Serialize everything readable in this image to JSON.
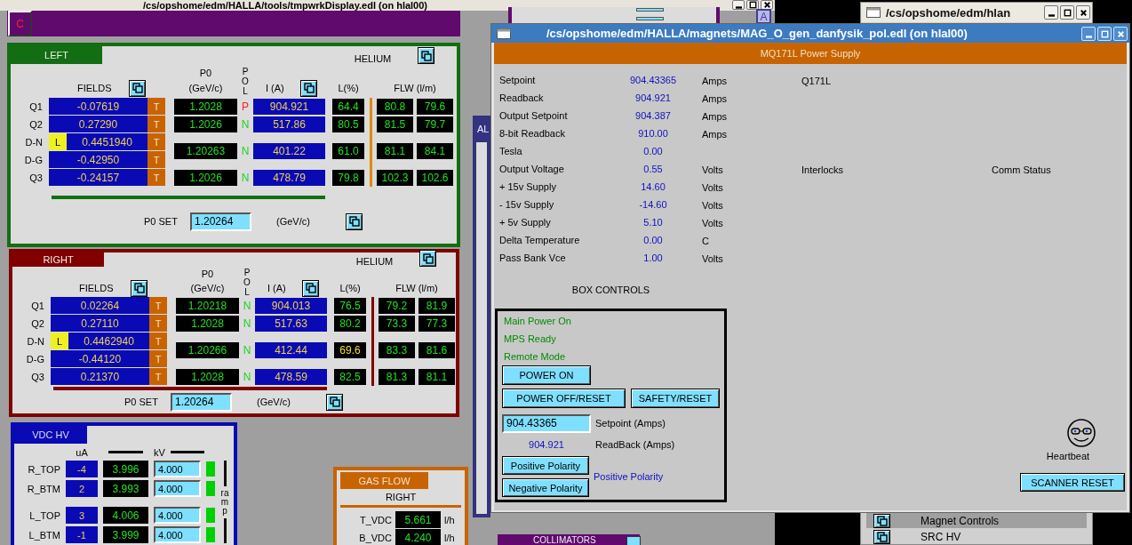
{
  "background_window": {
    "title": "/cs/opshome/edm/HALLA/tools/tmpwrkDisplay.edl (on hlal00)",
    "header_button": "C",
    "corner_button": "A",
    "alarm_panel_title": "AL",
    "collimators_title": "COLLIMATORS",
    "magnet_panels": [
      {
        "title": "LEFT",
        "color": "#136e13",
        "headers": {
          "fields": "FIELDS",
          "p0": "P0",
          "p0_unit": "(GeV/c)",
          "pol": "POL",
          "current": "I (A)",
          "helium": "HELIUM",
          "level": "L(%)",
          "flow": "FLW (l/m)"
        },
        "fields": [
          {
            "name": "Q1",
            "value": "-0.07619",
            "tag": "T"
          },
          {
            "name": "Q2",
            "value": "0.27290",
            "tag": "T"
          },
          {
            "name": "D-N",
            "value": "0.4451940",
            "tag": "T",
            "flag": "L"
          },
          {
            "name": "D-G",
            "value": "-0.42950",
            "tag": "T"
          },
          {
            "name": "Q3",
            "value": "-0.24157",
            "tag": "T"
          }
        ],
        "magnets": [
          {
            "p0": "1.2028",
            "pol": "P",
            "color": "#ff2020",
            "current": "904.921",
            "level": "64.4",
            "level_warning": false,
            "flow": [
              "80.8",
              "79.6"
            ]
          },
          {
            "p0": "1.2026",
            "pol": "N",
            "color": "#20d020",
            "current": "517.86",
            "level": "80.5",
            "level_warning": false,
            "flow": [
              "81.5",
              "79.7"
            ]
          },
          {
            "p0": "1.20263",
            "pol": "N",
            "color": "#20d020",
            "current": "401.22",
            "level": "61.0",
            "level_warning": false,
            "flow": [
              "81.1",
              "84.1"
            ]
          },
          {
            "p0": "1.2026",
            "pol": "N",
            "color": "#20d020",
            "current": "478.79",
            "level": "79.8",
            "level_warning": false,
            "flow": [
              "102.3",
              "102.6"
            ]
          }
        ],
        "p0_set": {
          "label": "P0 SET",
          "value": "1.20264",
          "unit": "(GeV/c)"
        }
      },
      {
        "title": "RIGHT",
        "color": "#800000",
        "headers": {
          "fields": "FIELDS",
          "p0": "P0",
          "p0_unit": "(GeV/c)",
          "pol": "POL",
          "current": "I (A)",
          "helium": "HELIUM",
          "level": "L(%)",
          "flow": "FLW (l/m)"
        },
        "fields": [
          {
            "name": "Q1",
            "value": "0.02264",
            "tag": "T"
          },
          {
            "name": "Q2",
            "value": "0.27110",
            "tag": "T"
          },
          {
            "name": "D-N",
            "value": "0.4462940",
            "tag": "T",
            "flag": "L"
          },
          {
            "name": "D-G",
            "value": "-0.44120",
            "tag": "T"
          },
          {
            "name": "Q3",
            "value": "0.21370",
            "tag": "T"
          }
        ],
        "magnets": [
          {
            "p0": "1.20218",
            "pol": "N",
            "color": "#20d020",
            "current": "904.013",
            "level": "76.5",
            "level_warning": false,
            "flow": [
              "79.2",
              "81.9"
            ]
          },
          {
            "p0": "1.2028",
            "pol": "N",
            "color": "#20d020",
            "current": "517.63",
            "level": "80.2",
            "level_warning": false,
            "flow": [
              "73.3",
              "77.3"
            ]
          },
          {
            "p0": "1.20266",
            "pol": "N",
            "color": "#20d020",
            "current": "412.44",
            "level": "69.6",
            "level_warning": true,
            "flow": [
              "83.3",
              "81.6"
            ]
          },
          {
            "p0": "1.2028",
            "pol": "N",
            "color": "#20d020",
            "current": "478.59",
            "level": "82.5",
            "level_warning": false,
            "flow": [
              "81.3",
              "81.1"
            ]
          }
        ],
        "p0_set": {
          "label": "P0 SET",
          "value": "1.20264",
          "unit": "(GeV/c)"
        }
      }
    ],
    "vdc_hv": {
      "title": "VDC HV",
      "current_unit": "uA",
      "voltage_unit": "kV",
      "ramp_label": "ramp",
      "channels": [
        {
          "name": "R_TOP",
          "current": "-4",
          "readback": "3.996",
          "setpoint": "4.000",
          "ok": true
        },
        {
          "name": "R_BTM",
          "current": "2",
          "readback": "3.993",
          "setpoint": "4.000",
          "ok": true
        },
        {
          "name": "L_TOP",
          "current": "3",
          "readback": "4.006",
          "setpoint": "4.000",
          "ok": true
        },
        {
          "name": "L_BTM",
          "current": "-1",
          "readback": "3.999",
          "setpoint": "4.000",
          "ok": true
        }
      ]
    },
    "gas_flow": {
      "title": "GAS FLOW",
      "side": "RIGHT",
      "rows": [
        {
          "name": "T_VDC",
          "value": "5.661",
          "unit": "l/h"
        },
        {
          "name": "B_VDC",
          "value": "4.240",
          "unit": "l/h"
        }
      ]
    }
  },
  "menu_window": {
    "title": "/cs/opshome/edm/hlan",
    "menu_items": [
      {
        "label": "Magnet Controls",
        "selected": true
      },
      {
        "label": "SRC HV",
        "selected": false
      }
    ]
  },
  "front_window": {
    "title": "/cs/opshome/edm/HALLA/magnets/MAG_O_gen_danfysik_pol.edl (on hlal00)",
    "header": "MQ171L Power Supply",
    "readings": [
      {
        "label": "Setpoint",
        "value": "904.43365",
        "unit": "Amps",
        "side_texts": [
          "Q171L"
        ]
      },
      {
        "label": "Readback",
        "value": "904.921",
        "unit": "Amps"
      },
      {
        "label": "Output Setpoint",
        "value": "904.387",
        "unit": "Amps"
      },
      {
        "label": "8-bit Readback",
        "value": "910.00",
        "unit": "Amps"
      },
      {
        "label": "Tesla",
        "value": "0.00"
      },
      {
        "label": "Output Voltage",
        "value": "0.55",
        "unit": "Volts",
        "side_texts": [
          "Interlocks",
          "Comm Status"
        ]
      },
      {
        "label": "+ 15v Supply",
        "value": "14.60",
        "unit": "Volts"
      },
      {
        "label": "- 15v Supply",
        "value": "-14.60",
        "unit": "Volts"
      },
      {
        "label": "+ 5v Supply",
        "value": "5.10",
        "unit": "Volts"
      },
      {
        "label": "Delta Temperature",
        "value": "0.00",
        "unit": "C"
      },
      {
        "label": "Pass Bank Vce",
        "value": "1.00",
        "unit": "Volts"
      }
    ],
    "box_controls": {
      "title": "BOX CONTROLS",
      "statuses": [
        {
          "text": "Main Power On",
          "on": true
        },
        {
          "text": "MPS Ready",
          "on": true
        },
        {
          "text": "Remote Mode",
          "on": true
        }
      ],
      "button_rows": [
        [
          "POWER ON"
        ],
        [
          "POWER OFF/RESET",
          "SAFETY/RESET"
        ]
      ],
      "setpoint": {
        "value": "904.43365",
        "label": "Setpoint (Amps)"
      },
      "readback": {
        "value": "904.921",
        "label": "ReadBack (Amps)"
      },
      "polarity_buttons": [
        "Positive Polarity",
        "Negative Polarity"
      ],
      "polarity_state": "Positive Polarity"
    },
    "heartbeat": "Heartbeat",
    "scanner_reset": "SCANNER RESET"
  }
}
